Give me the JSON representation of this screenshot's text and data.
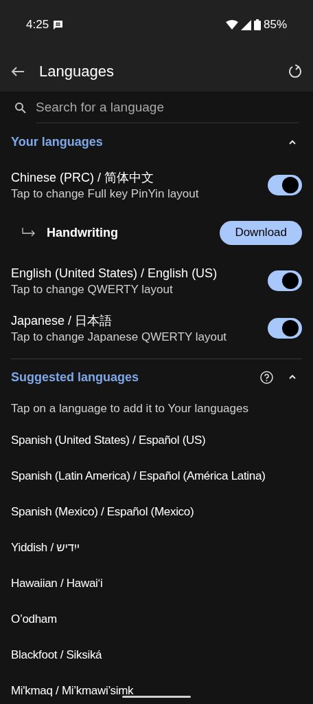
{
  "status_bar": {
    "time": "4:25",
    "battery": "85%"
  },
  "app_bar": {
    "title": "Languages"
  },
  "search": {
    "placeholder": "Search for a language"
  },
  "your_languages": {
    "title": "Your languages",
    "expanded": true,
    "items": [
      {
        "kind": "language",
        "name": "Chinese (PRC) / 简体中文",
        "subtitle": "Tap to change Full key PinYin layout",
        "on": true
      },
      {
        "kind": "addon",
        "name": "Handwriting",
        "action": "Download"
      },
      {
        "kind": "language",
        "name": "English (United States) / English (US)",
        "subtitle": "Tap to change QWERTY layout",
        "on": true
      },
      {
        "kind": "language",
        "name": "Japanese / 日本語",
        "subtitle": "Tap to change Japanese QWERTY layout",
        "on": true
      }
    ]
  },
  "suggested_languages": {
    "title": "Suggested languages",
    "expanded": true,
    "hint": "Tap on a language to add it to Your languages",
    "items": [
      "Spanish (United States) / Español (US)",
      "Spanish (Latin America) / Español (América Latina)",
      "Spanish (Mexico) / Español (Mexico)",
      "Yiddish / ייִדיש",
      "Hawaiian / Hawaiʻi",
      "O’odham",
      "Blackfoot / Siksiká",
      "Mi'kmaq / Mi’kmawi’simk"
    ]
  }
}
